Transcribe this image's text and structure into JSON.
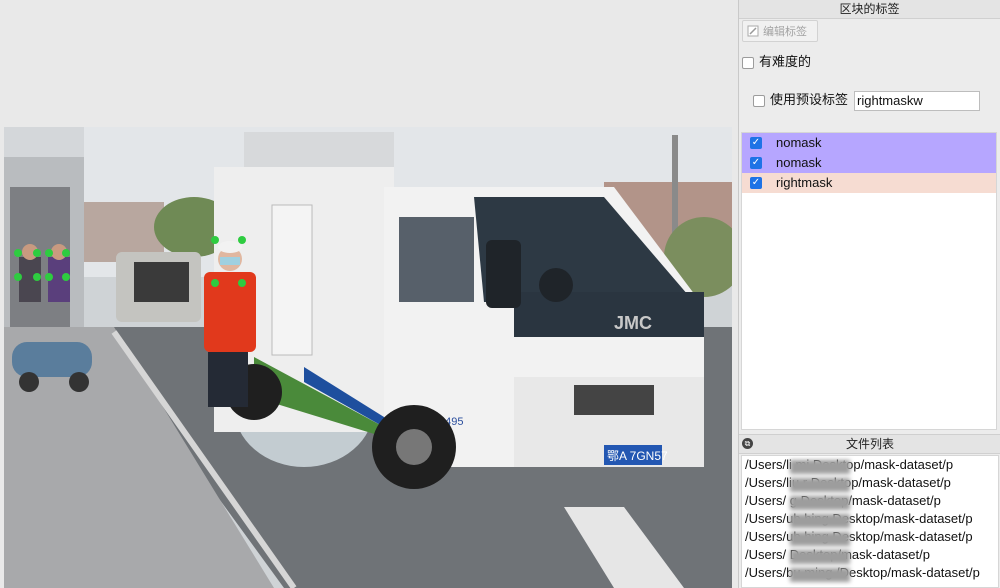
{
  "label_dock": {
    "title": "区块的标签",
    "edit_button_label": "编辑标签",
    "difficult_label": "有难度的",
    "use_default_label": "使用预设标签",
    "default_label_value": "rightmaskw"
  },
  "labels": [
    {
      "name": "nomask",
      "checked": true,
      "color": "#b6a6ff"
    },
    {
      "name": "nomask",
      "checked": true,
      "color": "#b6a6ff"
    },
    {
      "name": "rightmask",
      "checked": true,
      "color": "#f6dcd2"
    }
  ],
  "file_dock": {
    "title": "文件列表",
    "files": [
      "/Users/li    mi   Desktop/mask-dataset/p",
      "/Users/liu    r    Desktop/mask-dataset/p",
      "/Users/        g   Desktop/mask-dataset/p",
      "/Users/ub     hing Desktop/mask-dataset/p",
      "/Users/ub     hing Desktop/mask-dataset/p",
      "/Users/             Desktop/mask-dataset/p",
      "/Users/bu     ming /Desktop/mask-dataset/p"
    ]
  },
  "photo": {
    "plate_text": "鄂A 7GN57",
    "truck_brand": "JMC",
    "truck_side_number": "6495"
  }
}
